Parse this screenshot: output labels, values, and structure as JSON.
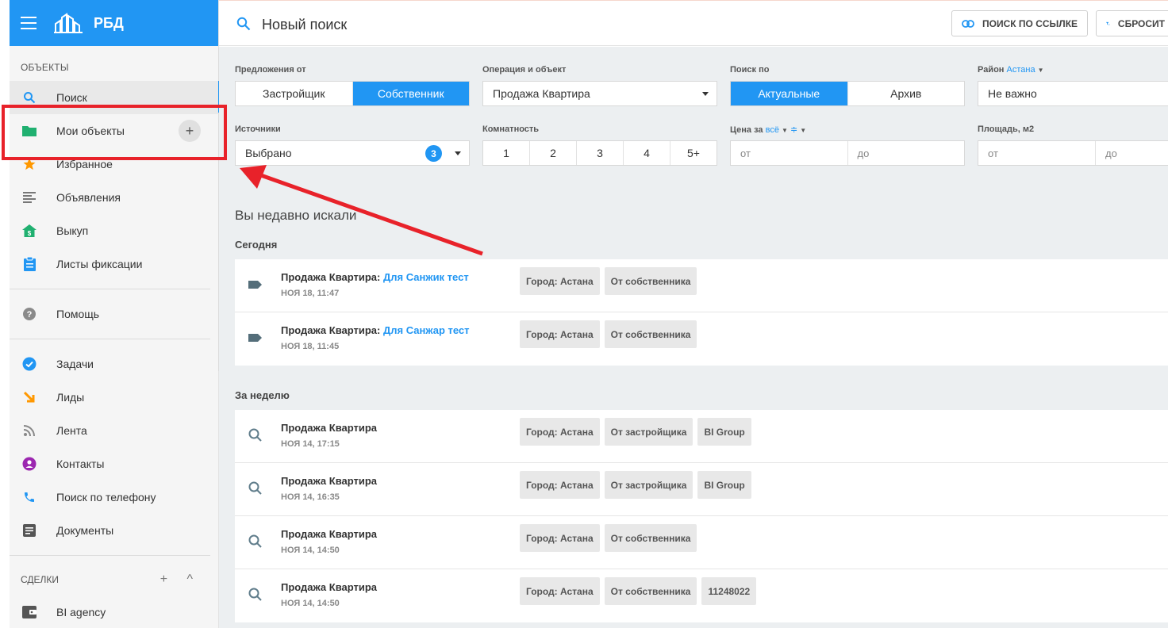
{
  "brand": {
    "name": "РБД"
  },
  "sidebar": {
    "section_objects": "ОБЪЕКТЫ",
    "items_main": [
      {
        "label": "Поиск",
        "icon": "search-icon",
        "color": "#2196f3"
      },
      {
        "label": "Мои объекты",
        "icon": "folder-icon",
        "color": "#20b070"
      },
      {
        "label": "Избранное",
        "icon": "star-icon",
        "color": "#ff9800"
      },
      {
        "label": "Объявления",
        "icon": "list-icon",
        "color": "#777777"
      },
      {
        "label": "Выкуп",
        "icon": "house-dollar-icon",
        "color": "#20b070"
      },
      {
        "label": "Листы фиксации",
        "icon": "clipboard-icon",
        "color": "#2196f3"
      }
    ],
    "plus_label": "+",
    "help": {
      "label": "Помощь",
      "icon": "help-icon"
    },
    "items_work": [
      {
        "label": "Задачи",
        "icon": "check-circle-icon",
        "color": "#2196f3"
      },
      {
        "label": "Лиды",
        "icon": "arrow-icon",
        "color": "#ff9800"
      },
      {
        "label": "Лента",
        "icon": "rss-icon",
        "color": "#777777"
      },
      {
        "label": "Контакты",
        "icon": "contact-icon",
        "color": "#9c27b0"
      },
      {
        "label": "Поиск по телефону",
        "icon": "phone-icon",
        "color": "#2196f3"
      },
      {
        "label": "Документы",
        "icon": "document-icon",
        "color": "#555555"
      }
    ],
    "section_deals": "СДЕЛКИ",
    "deals_actions": "+ ^",
    "deals_item": {
      "label": "BI agency",
      "icon": "wallet-icon"
    }
  },
  "topbar": {
    "title": "Новый поиск",
    "link_button": "ПОИСК ПО ССЫЛКЕ",
    "reset_button": "СБРОСИТ"
  },
  "filters": {
    "offers_label": "Предложения от",
    "offers_options": [
      "Застройщик",
      "Собственник"
    ],
    "operation_label": "Операция и объект",
    "operation_value": "Продажа Квартира",
    "search_by_label": "Поиск по",
    "search_by_options": [
      "Актуальные",
      "Архив"
    ],
    "district_label": "Район",
    "district_city": "Астана",
    "district_value": "Не важно",
    "sources_label": "Источники",
    "sources_value": "Выбрано",
    "sources_count": "3",
    "rooms_label": "Комнатность",
    "rooms_options": [
      "1",
      "2",
      "3",
      "4",
      "5+"
    ],
    "price_label": "Цена за",
    "price_unit": "всё",
    "price_from": "от",
    "price_to": "до",
    "area_label": "Площадь, м2",
    "area_from": "от",
    "area_to": "до"
  },
  "recent": {
    "title": "Вы недавно искали",
    "today_label": "Сегодня",
    "today": [
      {
        "title": "Продажа Квартира:",
        "link": "Для Санжик тест",
        "date": "НОЯ 18, 11:47",
        "chips": [
          "Город: Астана",
          "От собственника"
        ]
      },
      {
        "title": "Продажа Квартира:",
        "link": "Для Санжар тест",
        "date": "НОЯ 18, 11:45",
        "chips": [
          "Город: Астана",
          "От собственника"
        ]
      }
    ],
    "week_label": "За неделю",
    "week": [
      {
        "title": "Продажа Квартира",
        "date": "НОЯ 14, 17:15",
        "chips": [
          "Город: Астана",
          "От застройщика",
          "BI Group"
        ]
      },
      {
        "title": "Продажа Квартира",
        "date": "НОЯ 14, 16:35",
        "chips": [
          "Город: Астана",
          "От застройщика",
          "BI Group"
        ]
      },
      {
        "title": "Продажа Квартира",
        "date": "НОЯ 14, 14:50",
        "chips": [
          "Город: Астана",
          "От собственника"
        ]
      },
      {
        "title": "Продажа Квартира",
        "date": "НОЯ 14, 14:50",
        "chips": [
          "Город: Астана",
          "От собственника",
          "11248022"
        ]
      }
    ]
  },
  "colors": {
    "accent": "#2196f3",
    "annotation": "#e8222a"
  }
}
